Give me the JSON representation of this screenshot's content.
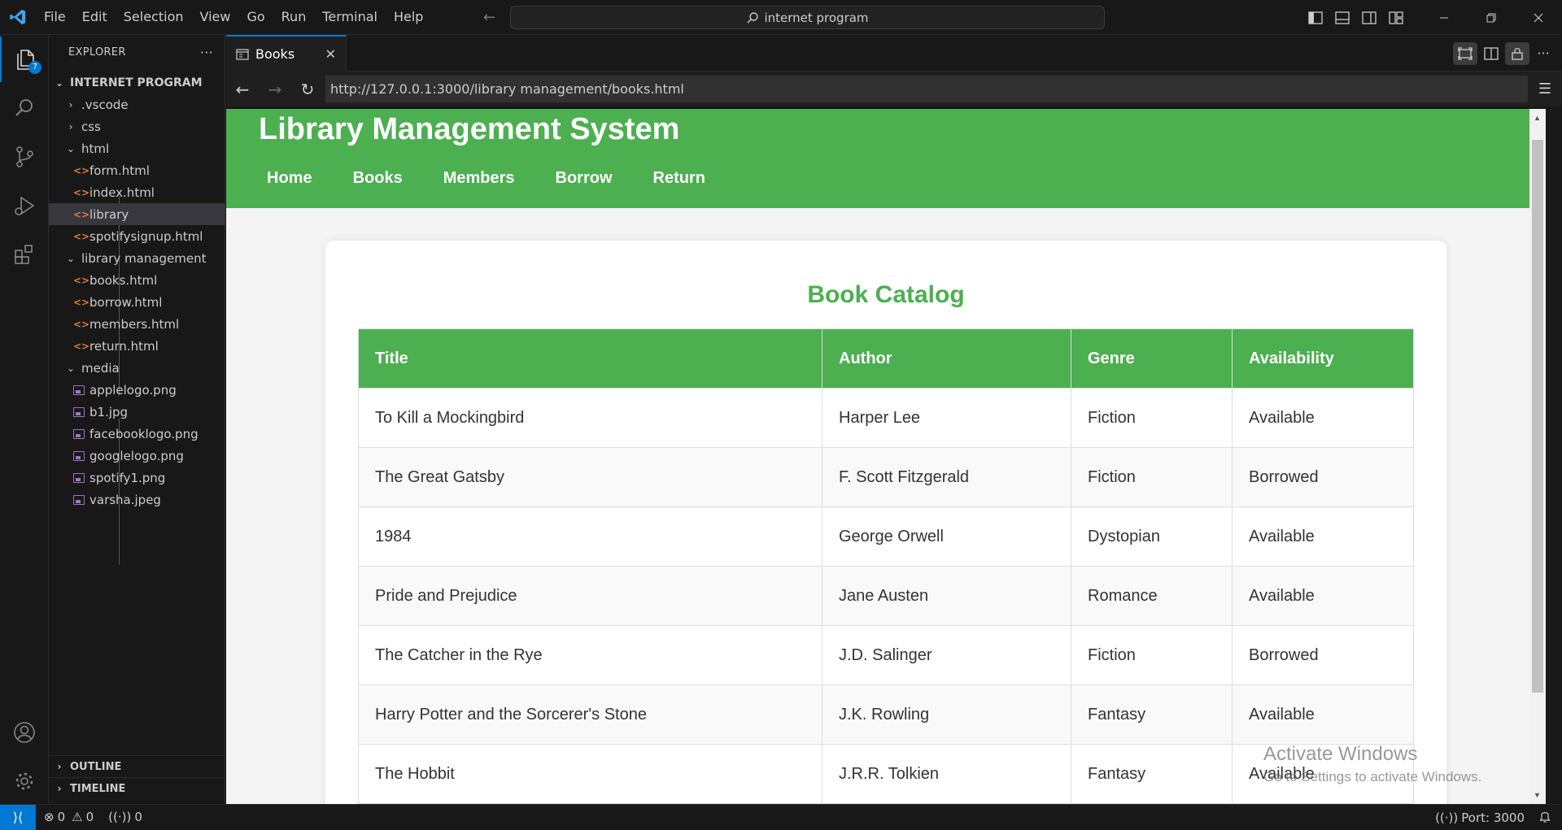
{
  "titlebar": {
    "menu": [
      "File",
      "Edit",
      "Selection",
      "View",
      "Go",
      "Run",
      "Terminal",
      "Help"
    ],
    "search_text": "internet program",
    "window_buttons": [
      "minimize",
      "restore",
      "close"
    ]
  },
  "activity": {
    "explorer_badge": "7",
    "items": [
      "explorer",
      "search",
      "source-control",
      "run-debug",
      "extensions",
      "accounts",
      "manage"
    ]
  },
  "sidebar": {
    "title": "EXPLORER",
    "more": "···",
    "root": "INTERNET PROGRAM",
    "tree": [
      {
        "label": ".vscode",
        "kind": "folder",
        "open": false
      },
      {
        "label": "css",
        "kind": "folder",
        "open": false
      },
      {
        "label": "html",
        "kind": "folder",
        "open": true
      },
      {
        "label": "form.html",
        "kind": "html"
      },
      {
        "label": "index.html",
        "kind": "html"
      },
      {
        "label": "library",
        "kind": "html",
        "selected": true
      },
      {
        "label": "spotifysignup.html",
        "kind": "html"
      },
      {
        "label": "library management",
        "kind": "folder",
        "open": true
      },
      {
        "label": "books.html",
        "kind": "html"
      },
      {
        "label": "borrow.html",
        "kind": "html"
      },
      {
        "label": "members.html",
        "kind": "html"
      },
      {
        "label": "return.html",
        "kind": "html"
      },
      {
        "label": "media",
        "kind": "folder",
        "open": true
      },
      {
        "label": "applelogo.png",
        "kind": "image"
      },
      {
        "label": "b1.jpg",
        "kind": "image"
      },
      {
        "label": "facebooklogo.png",
        "kind": "image"
      },
      {
        "label": "googlelogo.png",
        "kind": "image"
      },
      {
        "label": "spotify1.png",
        "kind": "image"
      },
      {
        "label": "varsha.jpeg",
        "kind": "image"
      }
    ],
    "outline": "OUTLINE",
    "timeline": "TIMELINE"
  },
  "editor": {
    "tab_label": "Books",
    "url": "http://127.0.0.1:3000/library management/books.html"
  },
  "page": {
    "site_title": "Library Management System",
    "nav": [
      "Home",
      "Books",
      "Members",
      "Borrow",
      "Return"
    ],
    "catalog_title": "Book Catalog",
    "columns": [
      "Title",
      "Author",
      "Genre",
      "Availability"
    ],
    "rows": [
      [
        "To Kill a Mockingbird",
        "Harper Lee",
        "Fiction",
        "Available"
      ],
      [
        "The Great Gatsby",
        "F. Scott Fitzgerald",
        "Fiction",
        "Borrowed"
      ],
      [
        "1984",
        "George Orwell",
        "Dystopian",
        "Available"
      ],
      [
        "Pride and Prejudice",
        "Jane Austen",
        "Romance",
        "Available"
      ],
      [
        "The Catcher in the Rye",
        "J.D. Salinger",
        "Fiction",
        "Borrowed"
      ],
      [
        "Harry Potter and the Sorcerer's Stone",
        "J.K. Rowling",
        "Fantasy",
        "Available"
      ],
      [
        "The Hobbit",
        "J.R.R. Tolkien",
        "Fantasy",
        "Available"
      ]
    ],
    "accent_color": "#4caf50"
  },
  "watermark": {
    "title": "Activate Windows",
    "subtitle": "Go to Settings to activate Windows."
  },
  "statusbar": {
    "errors": "0",
    "warnings": "0",
    "ports_count": "0",
    "port": "Port: 3000"
  }
}
